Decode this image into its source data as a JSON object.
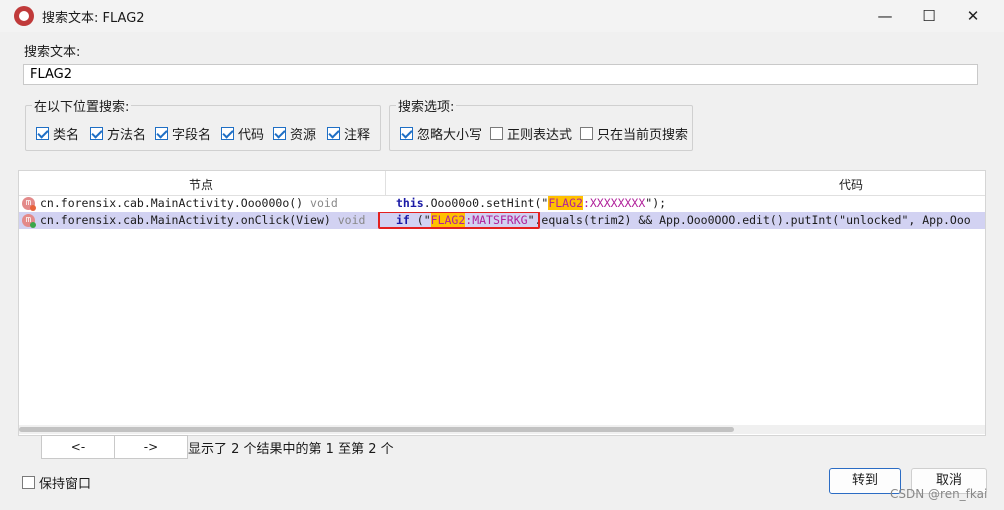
{
  "window": {
    "title": "搜索文本: FLAG2",
    "minimize_glyph": "—",
    "maximize_glyph": "☐",
    "close_glyph": "✕"
  },
  "search": {
    "label": "搜索文本:",
    "value": "FLAG2"
  },
  "location_group": {
    "title": "在以下位置搜索:",
    "options": [
      {
        "label": "类名",
        "checked": true
      },
      {
        "label": "方法名",
        "checked": true
      },
      {
        "label": "字段名",
        "checked": true
      },
      {
        "label": "代码",
        "checked": true
      },
      {
        "label": "资源",
        "checked": true
      },
      {
        "label": "注释",
        "checked": true
      }
    ]
  },
  "options_group": {
    "title": "搜索选项:",
    "options": [
      {
        "label": "忽略大小写",
        "checked": true
      },
      {
        "label": "正则表达式",
        "checked": false
      },
      {
        "label": "只在当前页搜索",
        "checked": false
      }
    ]
  },
  "table": {
    "headers": [
      "节点",
      "代码"
    ],
    "rows": [
      {
        "node": "cn.forensix.cab.MainActivity.Ooo000o()",
        "type": "void",
        "code_kw": "this",
        "code_pre": ".Ooo00o0.setHint(\"",
        "code_hl": "FLAG2",
        "code_str": ":XXXXXXXX",
        "code_post": "\");",
        "dot_color": "#e8643c"
      },
      {
        "node": "cn.forensix.cab.MainActivity.onClick(View)",
        "type": "void",
        "code_kw": "if",
        "code_pre": " (\"",
        "code_hl": "FLAG2",
        "code_str": ":MATSFRKG",
        "code_post": "\".equals(trim2) && App.Ooo0OOO.edit().putInt(\"unlocked\", App.Ooo",
        "dot_color": "#3aa64a",
        "selected": true
      }
    ]
  },
  "pagination": {
    "prev": "<-",
    "next": "->",
    "status": "显示了 2 个结果中的第 1 至第 2 个"
  },
  "footer": {
    "keep_window_label": "保持窗口",
    "keep_window_checked": false,
    "goto_label": "转到",
    "cancel_label": "取消"
  },
  "watermark": "CSDN @ren_fkai"
}
